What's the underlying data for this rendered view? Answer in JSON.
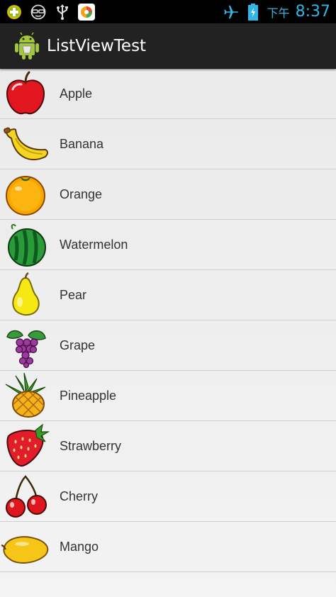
{
  "status_bar": {
    "ampm": "下午",
    "time": "8:37",
    "accent": "#33b5e5"
  },
  "action_bar": {
    "title": "ListViewTest",
    "icon": "android-robot-icon"
  },
  "fruits": [
    {
      "name": "Apple",
      "icon": "apple-icon"
    },
    {
      "name": "Banana",
      "icon": "banana-icon"
    },
    {
      "name": "Orange",
      "icon": "orange-icon"
    },
    {
      "name": "Watermelon",
      "icon": "watermelon-icon"
    },
    {
      "name": "Pear",
      "icon": "pear-icon"
    },
    {
      "name": "Grape",
      "icon": "grape-icon"
    },
    {
      "name": "Pineapple",
      "icon": "pineapple-icon"
    },
    {
      "name": "Strawberry",
      "icon": "strawberry-icon"
    },
    {
      "name": "Cherry",
      "icon": "cherry-icon"
    },
    {
      "name": "Mango",
      "icon": "mango-icon"
    }
  ]
}
